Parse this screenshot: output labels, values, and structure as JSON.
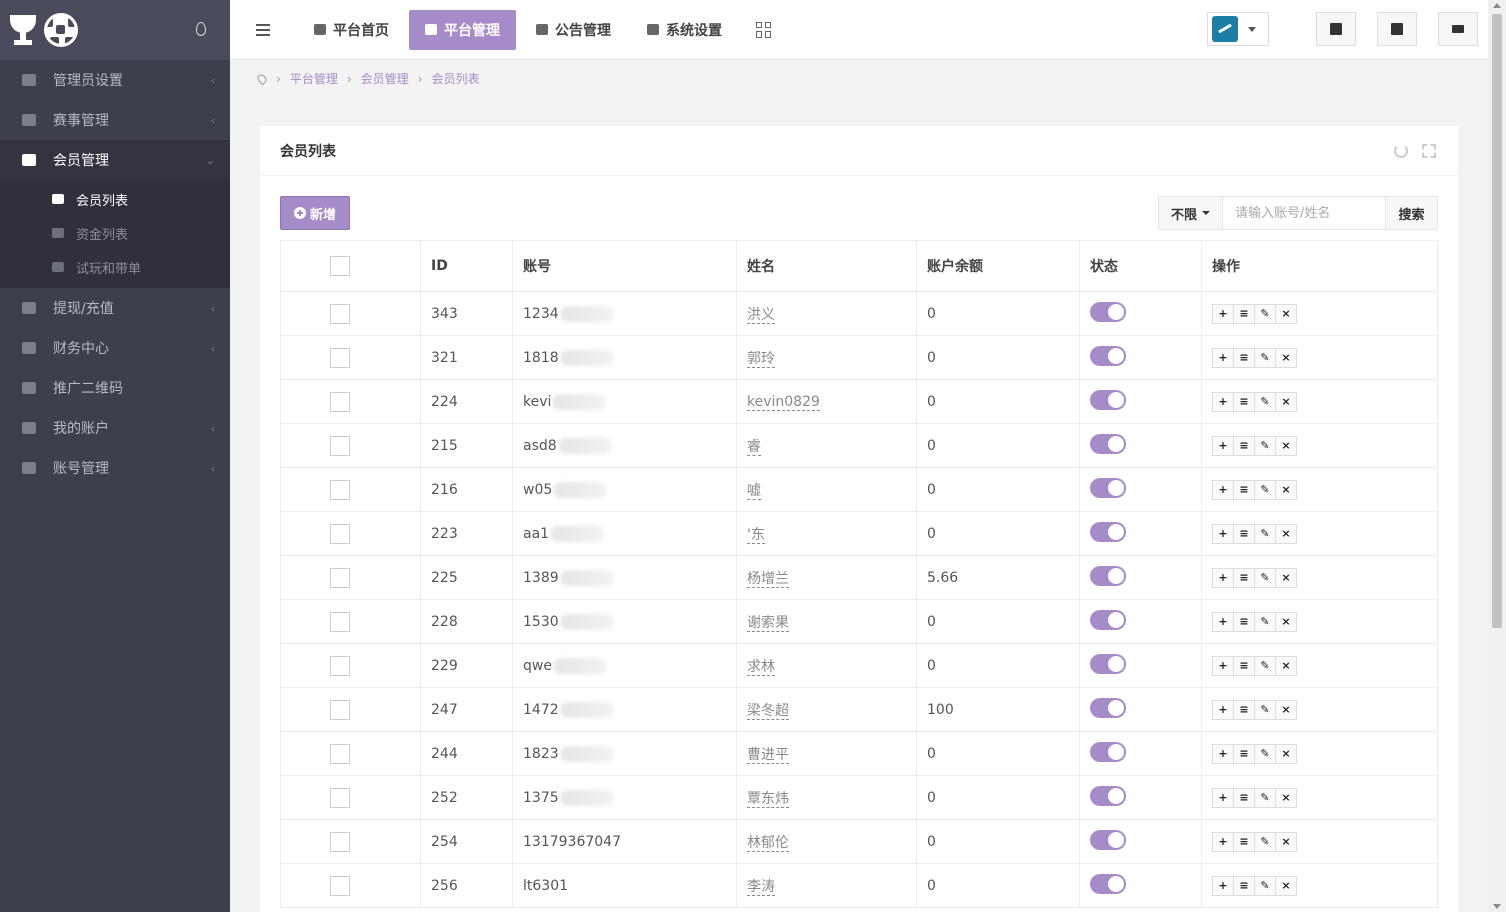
{
  "sidebar": {
    "items": [
      {
        "label": "管理员设置",
        "icon": "wrench-icon",
        "has_arrow": true
      },
      {
        "label": "赛事管理",
        "icon": "shirt-icon",
        "has_arrow": true
      },
      {
        "label": "会员管理",
        "icon": "tie-icon",
        "active": true
      }
    ],
    "submenu": [
      {
        "label": "会员列表",
        "icon": "users-icon",
        "active": true
      },
      {
        "label": "资金列表",
        "icon": "yen-icon"
      },
      {
        "label": "试玩和带单",
        "icon": "user-icon"
      }
    ],
    "items2": [
      {
        "label": "提现/充值",
        "icon": "won-icon"
      },
      {
        "label": "财务中心",
        "icon": "calendar-icon"
      },
      {
        "label": "推广二维码",
        "icon": "print-icon"
      },
      {
        "label": "我的账户",
        "icon": "book-icon"
      },
      {
        "label": "账号管理",
        "icon": "user-icon"
      }
    ]
  },
  "topnav": {
    "tabs": [
      {
        "label": "平台首页",
        "icon": "home-icon"
      },
      {
        "label": "平台管理",
        "icon": "user-icon",
        "active": true
      },
      {
        "label": "公告管理",
        "icon": "list-icon"
      },
      {
        "label": "系统设置",
        "icon": "gear-icon"
      }
    ]
  },
  "breadcrumb": [
    "平台管理",
    "会员管理",
    "会员列表"
  ],
  "panel": {
    "title": "会员列表",
    "add_label": "新增",
    "filter_label": "不限",
    "search_placeholder": "请输入账号/姓名",
    "search_label": "搜索"
  },
  "table": {
    "headers": [
      "ID",
      "账号",
      "姓名",
      "账户余额",
      "状态",
      "操作"
    ],
    "rows": [
      {
        "id": "343",
        "account": "1234",
        "name": "洪义",
        "balance": "0"
      },
      {
        "id": "321",
        "account": "1818",
        "name": "郭玲",
        "balance": "0"
      },
      {
        "id": "224",
        "account": "kevi",
        "name": "kevin0829",
        "balance": "0"
      },
      {
        "id": "215",
        "account": "asd8",
        "name": "睿",
        "balance": "0"
      },
      {
        "id": "216",
        "account": "w05",
        "name": "嘘",
        "balance": "0"
      },
      {
        "id": "223",
        "account": "aa1",
        "name": "'东",
        "balance": "0"
      },
      {
        "id": "225",
        "account": "1389",
        "name": "杨增兰",
        "balance": "5.66"
      },
      {
        "id": "228",
        "account": "1530",
        "name": "谢索果",
        "balance": "0"
      },
      {
        "id": "229",
        "account": "qwe",
        "name": "求林",
        "balance": "0"
      },
      {
        "id": "247",
        "account": "1472",
        "name": "梁冬超",
        "balance": "100"
      },
      {
        "id": "244",
        "account": "1823",
        "name": "曹进平",
        "balance": "0"
      },
      {
        "id": "252",
        "account": "1375",
        "name": "覃东炜",
        "balance": "0"
      },
      {
        "id": "254",
        "account": "13179367047",
        "name": "林郁伦",
        "balance": "0",
        "full": true
      },
      {
        "id": "256",
        "account": "lt6301",
        "name": "李涛",
        "balance": "0",
        "full": true
      }
    ]
  },
  "colors": {
    "accent": "#a58cc9",
    "sidebar": "#3e3f4d"
  }
}
